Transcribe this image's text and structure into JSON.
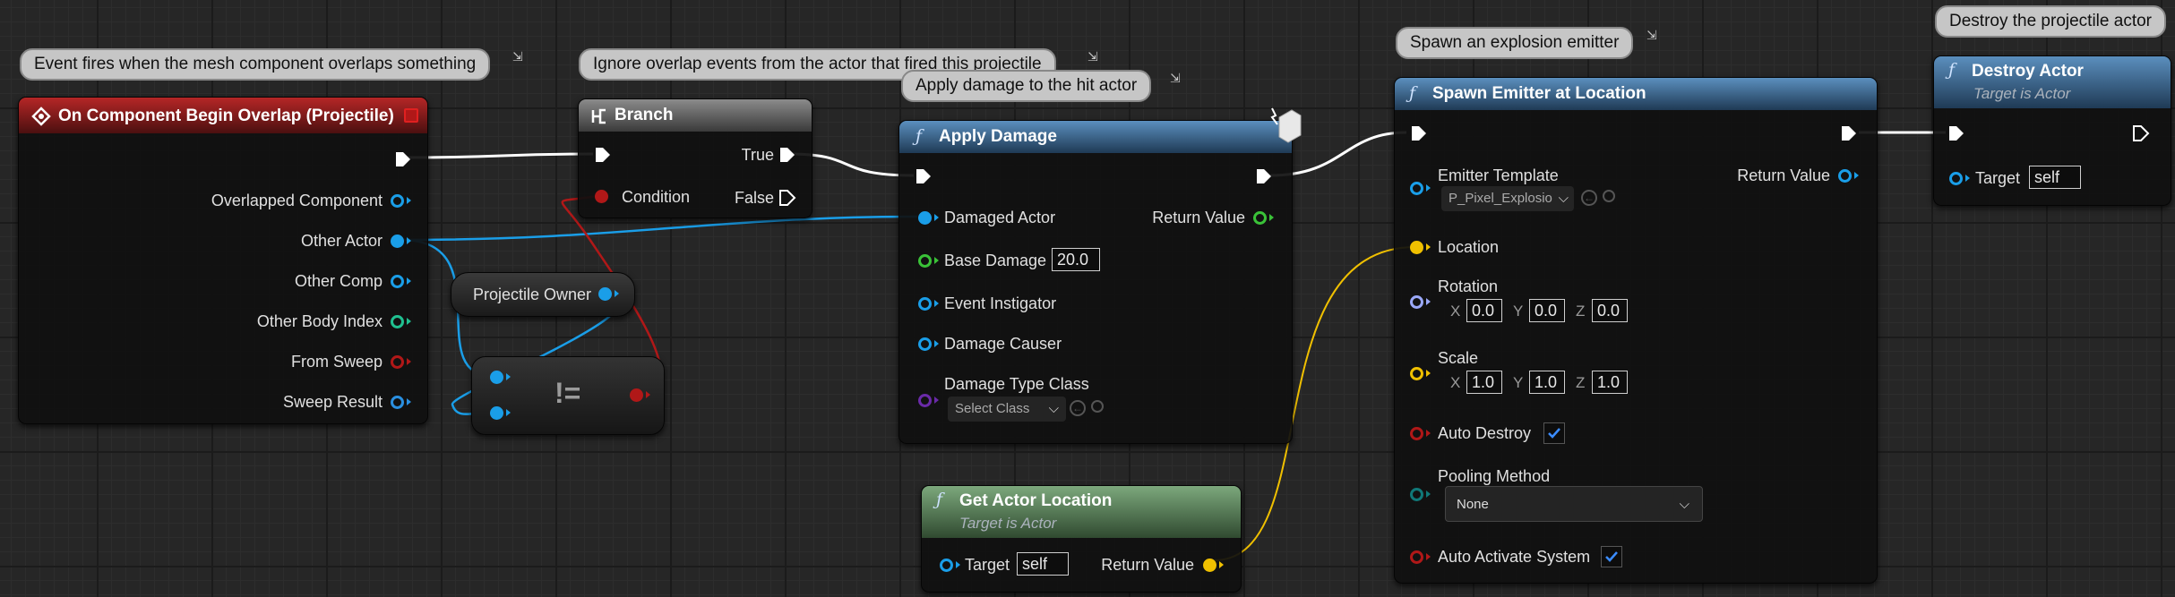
{
  "colors": {
    "exec": "#ffffff",
    "object": "#1a9ee8",
    "boolean": "#b01818",
    "float": "#3ac238",
    "struct": "#2a8fe0",
    "int": "#20c090",
    "class": "#6a2aa8",
    "vector": "#f0c000",
    "rotator": "#9aa8f8",
    "byte": "#107878"
  },
  "comments": {
    "overlap": "Event fires when the mesh component overlaps something",
    "ignore": "Ignore overlap events from the actor that fired this projectile",
    "apply": "Apply damage to the hit actor",
    "spawn": "Spawn an explosion emitter",
    "destroy": "Destroy the projectile actor"
  },
  "event_node": {
    "title": "On Component Begin Overlap (Projectile)",
    "pins": [
      "Overlapped Component",
      "Other Actor",
      "Other Comp",
      "Other Body Index",
      "From Sweep",
      "Sweep Result"
    ]
  },
  "branch_node": {
    "title": "Branch",
    "condition": "Condition",
    "true_label": "True",
    "false_label": "False"
  },
  "owner_node": {
    "label": "Projectile Owner"
  },
  "not_equal_node": {
    "op": "!="
  },
  "apply_damage": {
    "title": "Apply Damage",
    "damaged_actor": "Damaged Actor",
    "return_value": "Return Value",
    "base_damage": "Base Damage",
    "base_damage_value": "20.0",
    "event_instigator": "Event Instigator",
    "damage_causer": "Damage Causer",
    "damage_type_class": "Damage Type Class",
    "select_class": "Select Class"
  },
  "get_location": {
    "title": "Get Actor Location",
    "subtitle": "Target is Actor",
    "target": "Target",
    "target_value": "self",
    "return_value": "Return Value"
  },
  "spawn_emitter": {
    "title": "Spawn Emitter at Location",
    "emitter_template": "Emitter Template",
    "emitter_value": "P_Pixel_Explosio",
    "return_value": "Return Value",
    "location": "Location",
    "rotation": "Rotation",
    "rotation_values": [
      "0.0",
      "0.0",
      "0.0"
    ],
    "scale": "Scale",
    "scale_values": [
      "1.0",
      "1.0",
      "1.0"
    ],
    "axis_labels": [
      "X",
      "Y",
      "Z"
    ],
    "auto_destroy": "Auto Destroy",
    "auto_destroy_checked": true,
    "pooling_method": "Pooling Method",
    "pooling_value": "None",
    "auto_activate": "Auto Activate System",
    "auto_activate_checked": true
  },
  "destroy_actor": {
    "title": "Destroy Actor",
    "subtitle": "Target is Actor",
    "target": "Target",
    "target_value": "self"
  }
}
